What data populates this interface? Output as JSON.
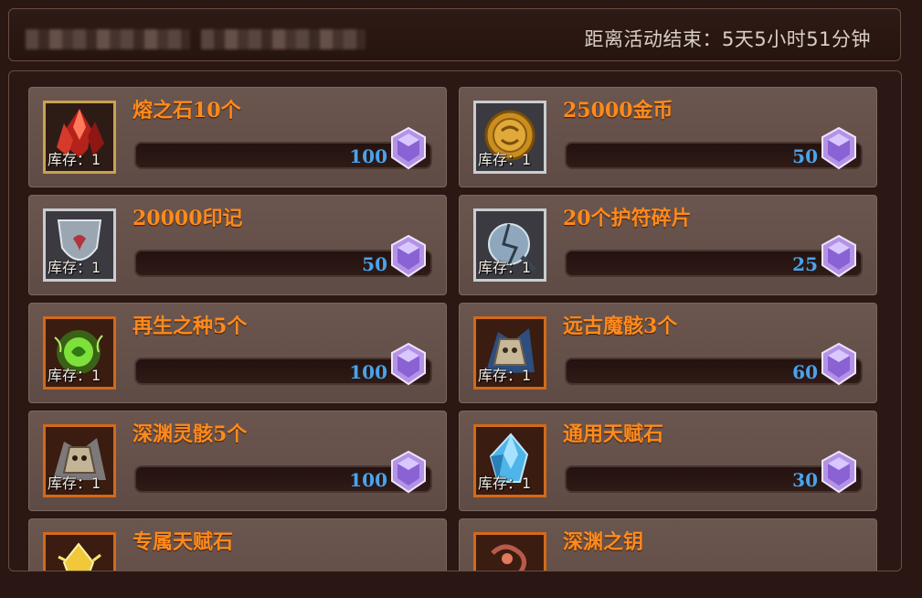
{
  "header": {
    "countdown_label": "距离活动结束：5天5小时51分钟"
  },
  "items": [
    {
      "name": "熔之石10个",
      "stock": "库存：1",
      "price": "100",
      "icon": "lava-stone-icon",
      "frame": "gold"
    },
    {
      "name": "25000金币",
      "stock": "库存：1",
      "price": "50",
      "icon": "gold-coin-icon",
      "frame": "silver"
    },
    {
      "name": "20000印记",
      "stock": "库存：1",
      "price": "50",
      "icon": "crest-shield-icon",
      "frame": "silver"
    },
    {
      "name": "20个护符碎片",
      "stock": "库存：1",
      "price": "25",
      "icon": "amulet-fragment-icon",
      "frame": "silver"
    },
    {
      "name": "再生之种5个",
      "stock": "库存：1",
      "price": "100",
      "icon": "regeneration-seed-icon",
      "frame": "orange"
    },
    {
      "name": "远古魔骸3个",
      "stock": "库存：1",
      "price": "60",
      "icon": "ancient-demon-remains-icon",
      "frame": "orange"
    },
    {
      "name": "深渊灵骸5个",
      "stock": "库存：1",
      "price": "100",
      "icon": "abyss-spirit-remains-icon",
      "frame": "orange"
    },
    {
      "name": "通用天赋石",
      "stock": "库存：1",
      "price": "30",
      "icon": "universal-talent-stone-icon",
      "frame": "orange"
    },
    {
      "name": "专属天赋石",
      "stock": "",
      "price": "",
      "icon": "exclusive-talent-stone-icon",
      "frame": "orange"
    },
    {
      "name": "深渊之钥",
      "stock": "",
      "price": "",
      "icon": "abyss-key-icon",
      "frame": "orange"
    }
  ],
  "currency_icon": "purple-crystal-icon",
  "colors": {
    "item_name": "#ff8a1c",
    "price": "#4aa3ea",
    "card_bg": "#6b564f",
    "page_bg": "#2a1714"
  }
}
